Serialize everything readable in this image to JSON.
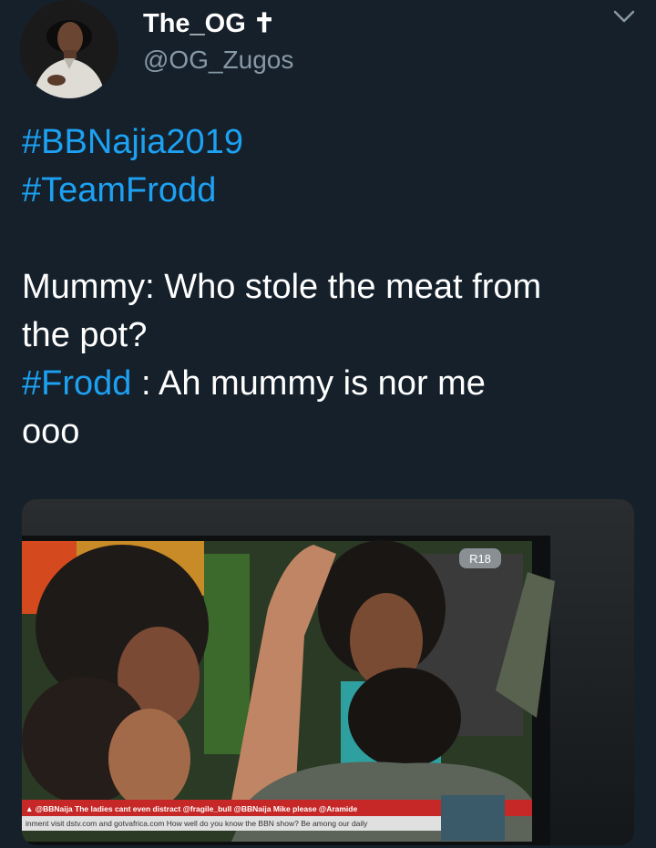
{
  "tweet": {
    "author_name": "The_OG ✝",
    "author_handle": "@OG_Zugos",
    "text_lines": [
      {
        "hashtag": "#BBNajia2019"
      },
      {
        "hashtag": "#TeamFrodd"
      },
      {
        "text": "Mummy: Who stole the meat from"
      },
      {
        "text": "the pot?"
      },
      {
        "hashtag": "#Frodd",
        "text": " : Ah mummy is nor me"
      },
      {
        "text": "ooo"
      }
    ]
  },
  "media": {
    "tv_badge": "R18",
    "ticker_top": "▲ @BBNaija The ladies cant even distract   @fragile_bull @BBNaija Mike please   @Aramide",
    "ticker_bottom": "inment visit dstv.com and gotvafrica.com   How well do you know the BBN show? Be among our daily"
  },
  "icons": {
    "menu": "chevron-down-icon"
  },
  "colors": {
    "background": "#15202b",
    "link": "#1da1f2",
    "secondary_text": "#8899a6"
  }
}
